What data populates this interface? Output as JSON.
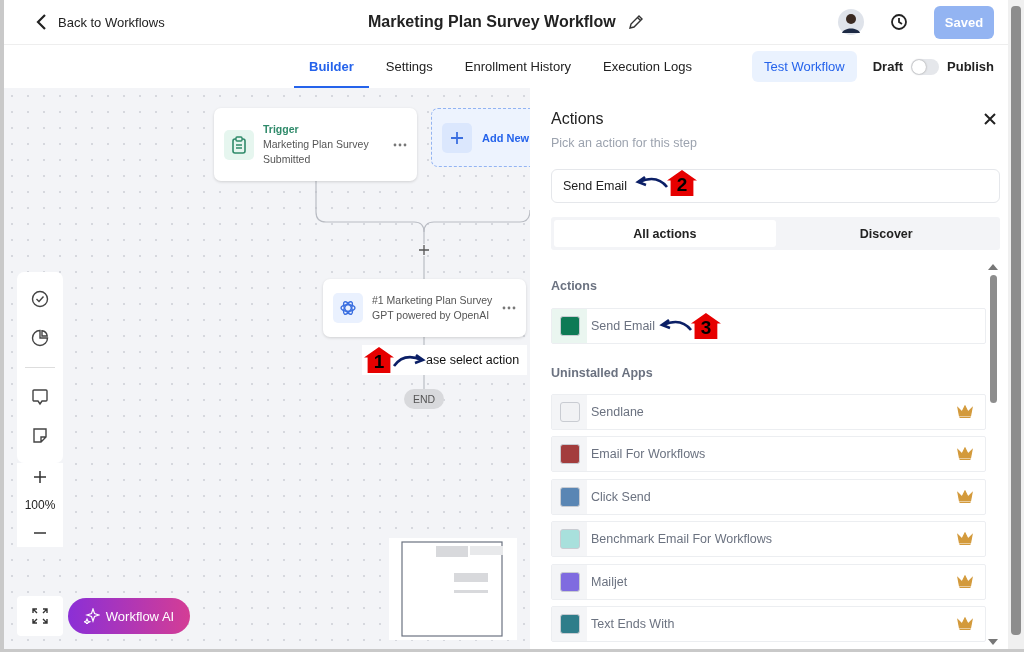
{
  "header": {
    "back": "Back to Workflows",
    "title": "Marketing Plan Survey Workflow",
    "save": {
      "label": "Saved",
      "disabled": true
    }
  },
  "tabs": [
    {
      "label": "Builder",
      "selected": true
    },
    {
      "label": "Settings",
      "selected": false
    },
    {
      "label": "Enrollment History",
      "selected": false
    },
    {
      "label": "Execution Logs",
      "selected": false
    }
  ],
  "test_button": "Test Workflow",
  "publish_toggle": {
    "off_label": "Draft",
    "on_label": "Publish",
    "on": false
  },
  "canvas": {
    "trigger": {
      "title": "Trigger",
      "text": "Marketing Plan Survey Submitted"
    },
    "add_trigger": "Add New",
    "step": {
      "text": "#1 Marketing Plan Survey GPT powered by OpenAI"
    },
    "action_hint": {
      "text": "ase select action",
      "annotation": "1"
    },
    "end": "END",
    "zoom": "100%",
    "ai_button": "Workflow AI"
  },
  "panel": {
    "title": "Actions",
    "subtitle": "Pick an action for this step",
    "search": {
      "value": "Send Email",
      "annotation": "2"
    },
    "tabs": [
      {
        "label": "All actions",
        "selected": true
      },
      {
        "label": "Discover",
        "selected": false
      }
    ],
    "sections": [
      {
        "title": "Actions",
        "items": [
          {
            "name": "Send Email",
            "premium": false,
            "color": "#0e7a55",
            "annotation": "3"
          }
        ]
      },
      {
        "title": "Uninstalled Apps",
        "items": [
          {
            "name": "Sendlane",
            "premium": true,
            "color": "#f1f2f4"
          },
          {
            "name": "Email For Workflows",
            "premium": true,
            "color": "#a33d3d"
          },
          {
            "name": "Click Send",
            "premium": true,
            "color": "#5a86b4"
          },
          {
            "name": "Benchmark Email For Workflows",
            "premium": true,
            "color": "#a8e0dc"
          },
          {
            "name": "Mailjet",
            "premium": true,
            "color": "#7f6be0"
          },
          {
            "name": "Text Ends With",
            "premium": true,
            "color": "#2f7d8a"
          }
        ]
      }
    ]
  }
}
